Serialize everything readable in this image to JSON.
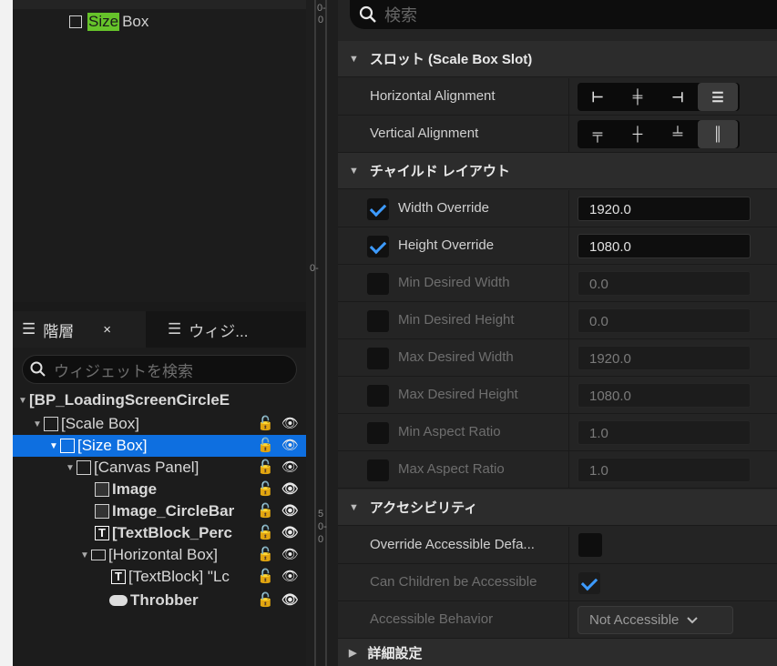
{
  "palette": {
    "preview_highlight": "Size",
    "preview_rest": "Box"
  },
  "ruler": {
    "marks_top": [
      "0-",
      "0"
    ],
    "mark_mid": "0-",
    "marks_bottom": [
      "5",
      "0-",
      "0"
    ]
  },
  "hierarchy": {
    "tab_label": "階層",
    "tab_close": "×",
    "tab2_label": "ウィジ...",
    "search_placeholder": "ウィジェットを検索",
    "items": [
      {
        "label": "[BP_LoadingScreenCircleE"
      },
      {
        "label": "[Scale Box]"
      },
      {
        "label": "[Size Box]"
      },
      {
        "label": "[Canvas Panel]"
      },
      {
        "label": "Image"
      },
      {
        "label": "Image_CircleBar"
      },
      {
        "label": "[TextBlock_Perc"
      },
      {
        "label": "[Horizontal Box]"
      },
      {
        "label": "[TextBlock] \"Lc"
      },
      {
        "label": "Throbber"
      }
    ]
  },
  "details": {
    "search_placeholder": "検索",
    "section_slot": "スロット (Scale Box Slot)",
    "horizontal_alignment": "Horizontal Alignment",
    "vertical_alignment": "Vertical Alignment",
    "section_child_layout": "チャイルド レイアウト",
    "width_override": {
      "label": "Width Override",
      "value": "1920.0",
      "checked": true
    },
    "height_override": {
      "label": "Height Override",
      "value": "1080.0",
      "checked": true
    },
    "min_desired_width": {
      "label": "Min Desired Width",
      "value": "0.0"
    },
    "min_desired_height": {
      "label": "Min Desired Height",
      "value": "0.0"
    },
    "max_desired_width": {
      "label": "Max Desired Width",
      "value": "1920.0"
    },
    "max_desired_height": {
      "label": "Max Desired Height",
      "value": "1080.0"
    },
    "min_aspect_ratio": {
      "label": "Min Aspect Ratio",
      "value": "1.0"
    },
    "max_aspect_ratio": {
      "label": "Max Aspect Ratio",
      "value": "1.0"
    },
    "section_accessibility": "アクセシビリティ",
    "override_accessible": "Override Accessible Defa...",
    "can_children": "Can Children be Accessible",
    "accessible_behavior": {
      "label": "Accessible Behavior",
      "value": "Not Accessible"
    },
    "section_advanced": "詳細設定"
  },
  "colors": {
    "selection": "#0e6fe0",
    "highlight": "#66c32a",
    "check": "#3d9bff"
  }
}
